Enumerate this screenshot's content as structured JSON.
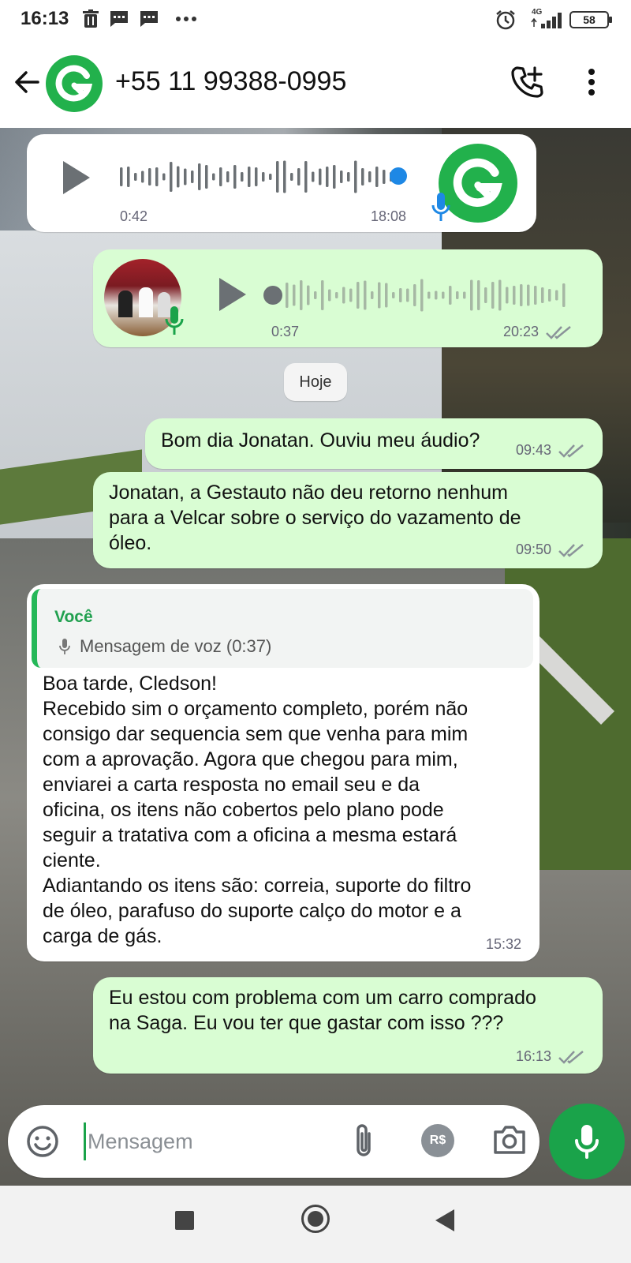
{
  "status_bar": {
    "time": "16:13",
    "battery": "58",
    "network": "4G",
    "icons": [
      "trash-icon",
      "message-icon",
      "message-icon",
      "more-icon",
      "alarm-icon",
      "signal-icon",
      "battery-icon"
    ]
  },
  "header": {
    "contact": "+55 11 99388-0995",
    "avatar_letter": "G",
    "accent": "#22b14c"
  },
  "messages": [
    {
      "type": "voice",
      "direction": "in",
      "duration": "0:42",
      "time": "18:08"
    },
    {
      "type": "voice",
      "direction": "out",
      "duration": "0:37",
      "time": "20:23"
    }
  ],
  "date_divider": "Hoje",
  "text_messages": [
    {
      "direction": "out",
      "text": "Bom dia Jonatan. Ouviu meu áudio?",
      "time": "09:43"
    },
    {
      "direction": "out",
      "text": "Jonatan, a Gestauto não deu retorno nenhum\npara a Velcar sobre o serviço do vazamento de\nóleo.",
      "time": "09:50"
    },
    {
      "direction": "in",
      "quote_author": "Você",
      "quote_text": "Mensagem de voz (0:37)",
      "text": "Boa tarde, Cledson!\nRecebido sim o orçamento completo, porém não\nconsigo dar sequencia sem que venha para mim\ncom a aprovação. Agora que chegou para mim,\nenviarei a carta resposta no email seu e da\noficina, os itens não cobertos pelo plano pode\nseguir a tratativa com a oficina a mesma estará\nciente.\nAdiantando os itens são: correia, suporte do filtro\nde óleo, parafuso do suporte calço do motor e a\ncarga de gás.",
      "time": "15:32"
    },
    {
      "direction": "out",
      "text": "Eu estou com problema com um carro comprado\nna Saga. Eu vou ter que gastar com isso ???",
      "time": "16:13"
    }
  ],
  "input": {
    "placeholder": "Mensagem",
    "value": "",
    "pay_label": "R$"
  },
  "colors": {
    "outgoing_bubble": "#d9fdd3",
    "incoming_bubble": "#ffffff",
    "brand_green": "#1aa34a",
    "read_ticks": "#8a9399"
  }
}
